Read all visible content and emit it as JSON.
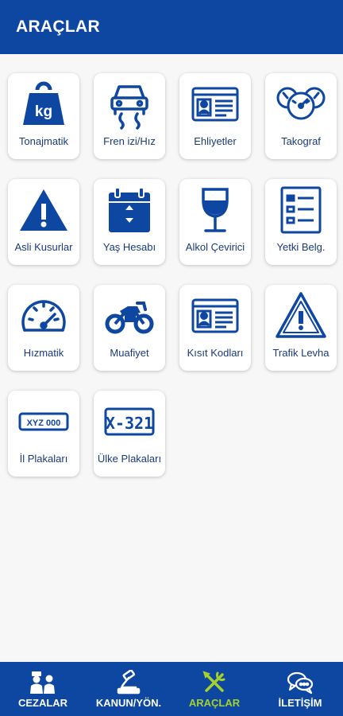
{
  "header": {
    "title": "ARAÇLAR"
  },
  "colors": {
    "brand": "#0d47a1",
    "icon": "#0d47a1",
    "active_tab": "#a4d12e",
    "tile_bg": "#ffffff"
  },
  "tools": [
    {
      "label": "Tonajmatik",
      "icon": "weight-kg-icon"
    },
    {
      "label": "Fren izi/Hız",
      "icon": "car-brake-trace-icon"
    },
    {
      "label": "Ehliyetler",
      "icon": "license-card-icon"
    },
    {
      "label": "Takograf",
      "icon": "tachograph-gauges-icon"
    },
    {
      "label": "Asli Kusurlar",
      "icon": "warning-triangle-icon"
    },
    {
      "label": "Yaş Hesabı",
      "icon": "calendar-icon"
    },
    {
      "label": "Alkol Çevirici",
      "icon": "wine-glass-icon"
    },
    {
      "label": "Yetki Belg.",
      "icon": "document-list-icon"
    },
    {
      "label": "Hızmatik",
      "icon": "speedometer-icon"
    },
    {
      "label": "Muafiyet",
      "icon": "motorcycle-icon"
    },
    {
      "label": "Kısıt Kodları",
      "icon": "license-card-icon"
    },
    {
      "label": "Trafik Levha",
      "icon": "traffic-sign-icon"
    },
    {
      "label": "İl Plakaları",
      "icon": "license-plate-icon",
      "plate_text": "XYZ 000"
    },
    {
      "label": "Ülke Plakaları",
      "icon": "country-plate-icon",
      "plate_text": "X-321"
    }
  ],
  "bottom_nav": [
    {
      "label": "CEZALAR",
      "icon": "police-officer-icon",
      "active": false
    },
    {
      "label": "KANUN/YÖN.",
      "icon": "gavel-icon",
      "active": false
    },
    {
      "label": "ARAÇLAR",
      "icon": "tools-icon",
      "active": true
    },
    {
      "label": "İLETİŞİM",
      "icon": "chat-bubbles-icon",
      "active": false
    }
  ]
}
